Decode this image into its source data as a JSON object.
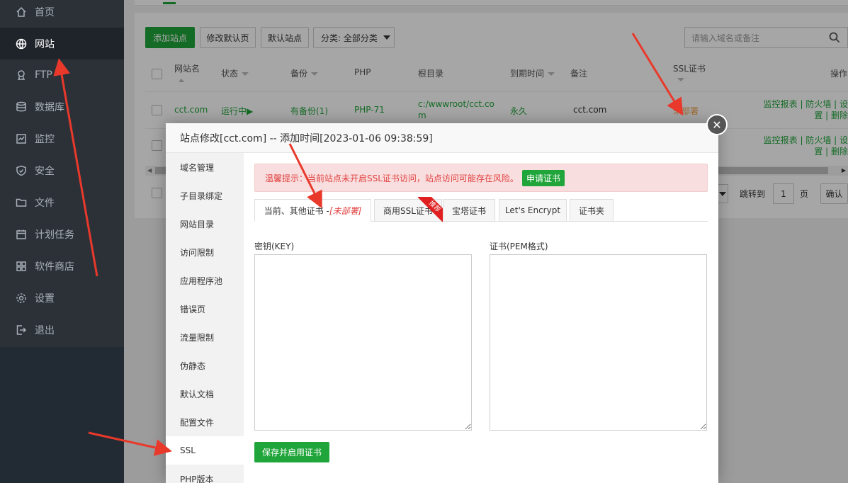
{
  "sidebar": {
    "items": [
      {
        "label": "首页",
        "icon": "home-icon"
      },
      {
        "label": "网站",
        "icon": "globe-icon",
        "active": true
      },
      {
        "label": "FTP",
        "icon": "ftp-icon"
      },
      {
        "label": "数据库",
        "icon": "database-icon"
      },
      {
        "label": "监控",
        "icon": "monitor-icon"
      },
      {
        "label": "安全",
        "icon": "shield-icon"
      },
      {
        "label": "文件",
        "icon": "folder-icon"
      },
      {
        "label": "计划任务",
        "icon": "calendar-icon"
      },
      {
        "label": "软件商店",
        "icon": "grid-icon"
      },
      {
        "label": "设置",
        "icon": "gear-icon"
      },
      {
        "label": "退出",
        "icon": "logout-icon"
      }
    ]
  },
  "toolbar": {
    "add_site": "添加站点",
    "edit_default_page": "修改默认页",
    "default_site": "默认站点",
    "category": "分类: 全部分类",
    "search_placeholder": "请输入域名或备注"
  },
  "table": {
    "headers": [
      "网站名",
      "状态",
      "备份",
      "PHP",
      "根目录",
      "到期时间",
      "备注",
      "SSL证书",
      "操作"
    ],
    "row": {
      "name": "cct.com",
      "status": "运行中▶",
      "backup": "有备份(1)",
      "php": "PHP-71",
      "root_line1": "c:/wwwroot/cct.co",
      "root_line2": "m",
      "expire": "永久",
      "note": "cct.com",
      "ssl": "未部署",
      "ops_line1": "监控报表 | 防火墙 | 设",
      "ops_line2": "置 | 删除"
    },
    "row2_ops_line1": "监控报表 | 防火墙 | 设",
    "row2_ops_line2": "置 | 删除"
  },
  "pagination": {
    "jump_to": "跳转到",
    "page_value": "1",
    "page_unit": "页",
    "confirm": "确认"
  },
  "modal": {
    "title": "站点修改[cct.com] -- 添加时间[2023-01-06 09:38:59]",
    "menu": [
      "域名管理",
      "子目录绑定",
      "网站目录",
      "访问限制",
      "应用程序池",
      "错误页",
      "流量限制",
      "伪静态",
      "默认文档",
      "配置文件",
      "SSL",
      "PHP版本"
    ],
    "warning": "温馨提示：当前站点未开启SSL证书访问，站点访问可能存在风险。",
    "apply_cert": "申请证书",
    "tabs": [
      "当前、其他证书 - ",
      "商用SSL证书",
      "宝塔证书",
      "Let's Encrypt",
      "证书夹"
    ],
    "tab_status": "[未部署]",
    "ribbon": "推荐",
    "key_label": "密钥(KEY)",
    "cert_label": "证书(PEM格式)",
    "save_button": "保存并启用证书"
  },
  "colors": {
    "accent": "#20a53a",
    "warning_text": "#e24141",
    "sidebar_bg": "#2c3138",
    "arrow": "#e8392b"
  }
}
